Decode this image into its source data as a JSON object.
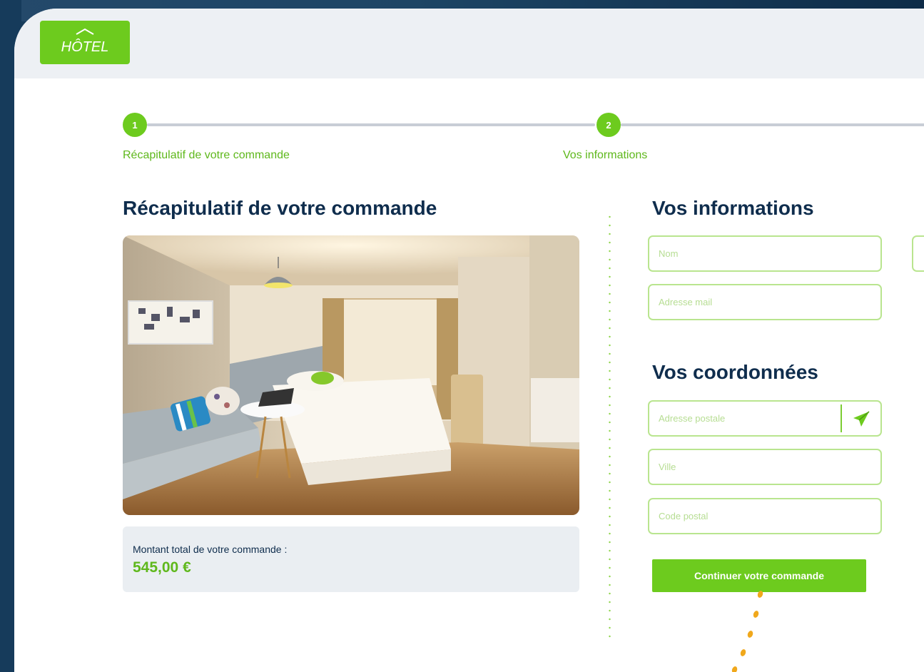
{
  "brand": {
    "logo_text": "HÔTEL",
    "accent": "#6dcb1e",
    "navy": "#0f2d4d"
  },
  "stepper": {
    "steps": [
      {
        "number": "1",
        "label": "Récapitulatif de votre commande"
      },
      {
        "number": "2",
        "label": "Vos informations"
      }
    ]
  },
  "summary": {
    "title": "Récapitulatif de votre commande",
    "photo_alt": "hotel-room-photo",
    "total_label": "Montant total de votre commande :",
    "total_value": "545,00 €"
  },
  "info_section": {
    "title": "Vos informations",
    "name_placeholder": "Nom",
    "email_placeholder": "Adresse mail"
  },
  "address_section": {
    "title": "Vos coordonnées",
    "street_placeholder": "Adresse postale",
    "city_placeholder": "Ville",
    "zip_placeholder": "Code postal"
  },
  "cta_label": "Continuer votre commande",
  "icons": {
    "send": "paper-plane-icon",
    "roof": "roof-icon"
  }
}
